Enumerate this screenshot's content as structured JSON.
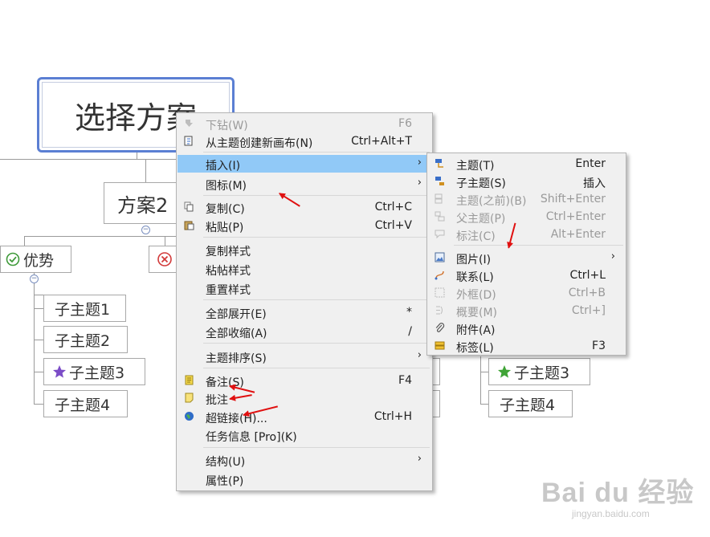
{
  "mindmap": {
    "central": "选择方案",
    "branch": "方案2",
    "pros_label": "优势",
    "left_children": [
      "子主题1",
      "子主题2",
      "子主题3",
      "子主题4"
    ],
    "right_children": [
      "子主题3",
      "子主题4"
    ]
  },
  "context_menu": {
    "items": [
      {
        "label": "下钻(W)",
        "shortcut": "F6"
      },
      {
        "label": "从主题创建新画布(N)",
        "shortcut": "Ctrl+Alt+T"
      },
      {
        "label": "插入(I)",
        "shortcut": ""
      },
      {
        "label": "图标(M)",
        "shortcut": ""
      },
      {
        "label": "复制(C)",
        "shortcut": "Ctrl+C"
      },
      {
        "label": "粘贴(P)",
        "shortcut": "Ctrl+V"
      },
      {
        "label": "复制样式",
        "shortcut": ""
      },
      {
        "label": "粘帖样式",
        "shortcut": ""
      },
      {
        "label": "重置样式",
        "shortcut": ""
      },
      {
        "label": "全部展开(E)",
        "shortcut": "*"
      },
      {
        "label": "全部收缩(A)",
        "shortcut": "/"
      },
      {
        "label": "主题排序(S)",
        "shortcut": ""
      },
      {
        "label": "备注(S)",
        "shortcut": "F4"
      },
      {
        "label": "批注",
        "shortcut": ""
      },
      {
        "label": "超链接(H)...",
        "shortcut": "Ctrl+H"
      },
      {
        "label": "任务信息 [Pro](K)",
        "shortcut": ""
      },
      {
        "label": "结构(U)",
        "shortcut": ""
      },
      {
        "label": "属性(P)",
        "shortcut": ""
      }
    ]
  },
  "submenu": {
    "items": [
      {
        "label": "主题(T)",
        "shortcut": "Enter"
      },
      {
        "label": "子主题(S)",
        "shortcut": "插入"
      },
      {
        "label": "主题(之前)(B)",
        "shortcut": "Shift+Enter"
      },
      {
        "label": "父主题(P)",
        "shortcut": "Ctrl+Enter"
      },
      {
        "label": "标注(C)",
        "shortcut": "Alt+Enter"
      },
      {
        "label": "图片(I)",
        "shortcut": ""
      },
      {
        "label": "联系(L)",
        "shortcut": "Ctrl+L"
      },
      {
        "label": "外框(D)",
        "shortcut": "Ctrl+B"
      },
      {
        "label": "概要(M)",
        "shortcut": "Ctrl+]"
      },
      {
        "label": "附件(A)",
        "shortcut": ""
      },
      {
        "label": "标签(L)",
        "shortcut": "F3"
      }
    ]
  },
  "watermark": {
    "brand": "Bai du 经验",
    "url": "jingyan.baidu.com"
  },
  "colors": {
    "highlight": "#91c9f7",
    "central_border": "#5b7fd3",
    "annotation": "#e01010"
  }
}
